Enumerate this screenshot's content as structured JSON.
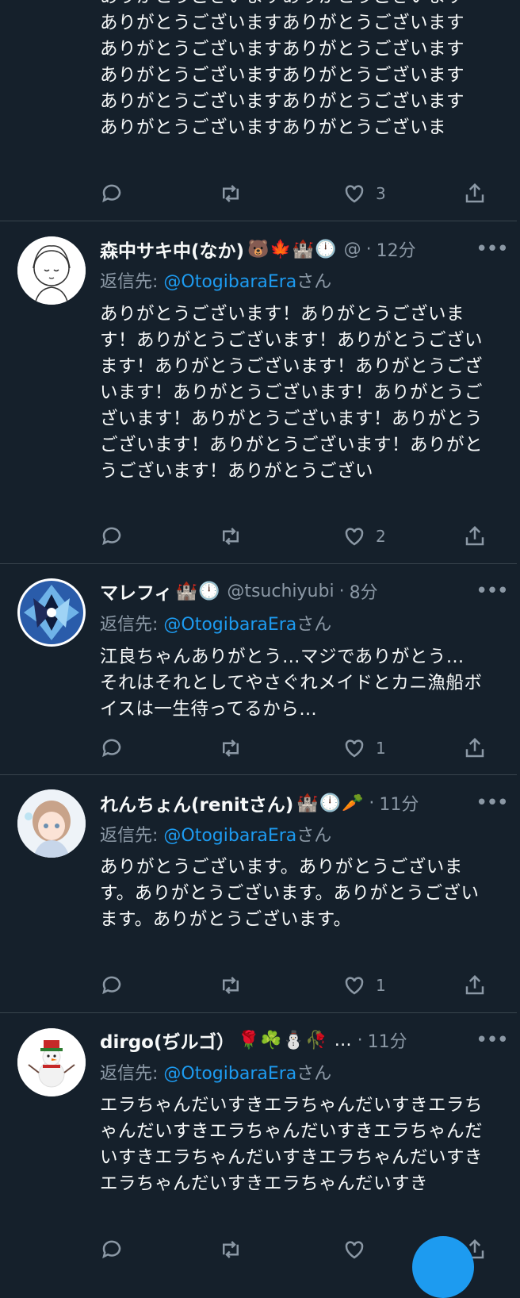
{
  "tweets": [
    {
      "body": "ありがとうございますありがとうございます\nありがとうございますありがとうございます\nありがとうございますありがとうございます\nありがとうございますありがとうございます\nありがとうございますありがとうございます\nありがとうございますありがとうございま",
      "like_count": "3"
    },
    {
      "name": "森中サキ中(なか)",
      "emojis": "🐻🍁🏰🕛",
      "handle": "@",
      "dot": "·",
      "time": "12分",
      "reply_prefix": "返信先: ",
      "reply_mention": "@OtogibaraEra",
      "reply_suffix": "さん",
      "body": "ありがとうございます！ありがとうございます！ありがとうございます！ありがとうございます！ありがとうございます！ありがとうございます！ありがとうございます！ありがとうございます！ありがとうございます！ありがとうございます！ありがとうございます！ありがとうございます！ありがとうござい",
      "like_count": "2"
    },
    {
      "name": "マレフィ",
      "emojis": "🏰🕛",
      "handle": "@tsuchiyubi",
      "dot": "·",
      "time": "8分",
      "reply_prefix": "返信先: ",
      "reply_mention": "@OtogibaraEra",
      "reply_suffix": "さん",
      "body": "江良ちゃんありがとう…マジでありがとう…\nそれはそれとしてやさぐれメイドとカニ漁船ボイスは一生待ってるから…",
      "like_count": "1"
    },
    {
      "name": "れんちょん(renitさん)",
      "emojis": "🏰🕛🥕",
      "handle": "",
      "dot": "·",
      "time": "11分",
      "reply_prefix": "返信先: ",
      "reply_mention": "@OtogibaraEra",
      "reply_suffix": "さん",
      "body": "ありがとうございます。ありがとうございます。ありがとうございます。ありがとうございます。ありがとうございます。",
      "like_count": "1"
    },
    {
      "name": "dirgo(ぢルゴ）",
      "emojis": "🌹☘️⛄🥀 …",
      "handle": "",
      "dot": "·",
      "time": "11分",
      "reply_prefix": "返信先: ",
      "reply_mention": "@OtogibaraEra",
      "reply_suffix": "さん",
      "body": "エラちゃんだいすきエラちゃんだいすきエラちゃんだいすきエラちゃんだいすきエラちゃんだいすきエラちゃんだいすきエラちゃんだいすきエラちゃんだいすきエラちゃんだいすき",
      "like_count": ""
    }
  ],
  "colors": {
    "background": "#15202b",
    "divider": "#38444d",
    "secondary": "#8b98a5",
    "accent": "#1d9bf0"
  }
}
